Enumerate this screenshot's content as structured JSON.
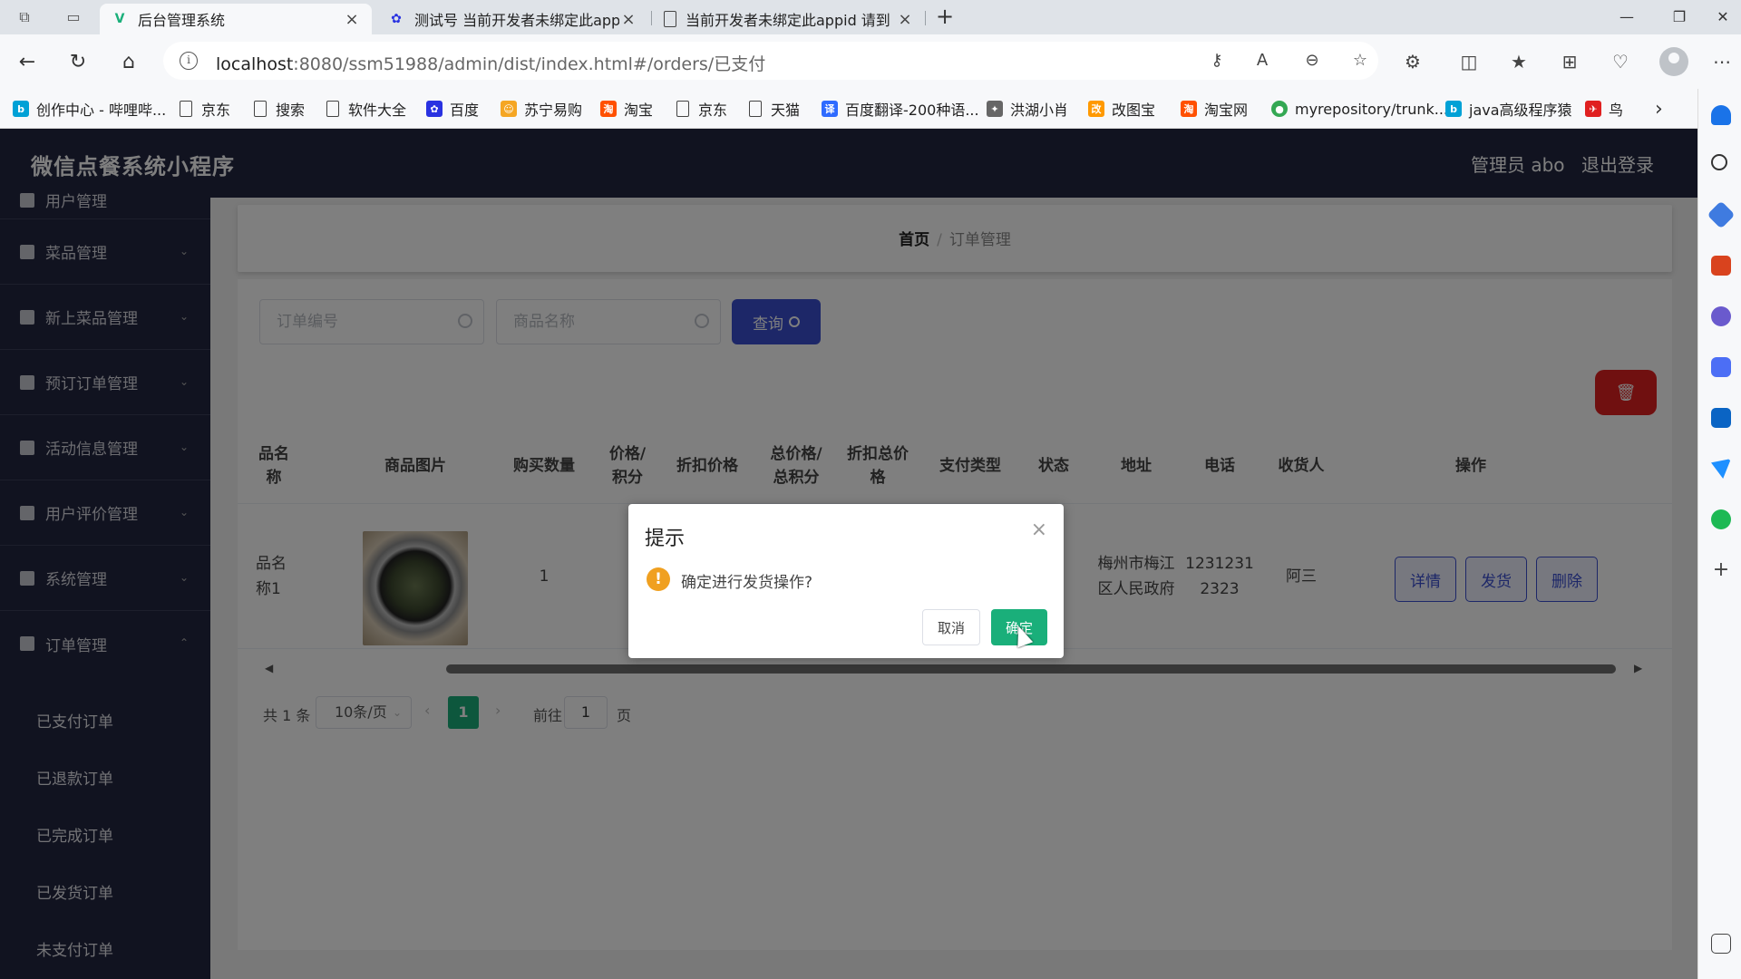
{
  "browser": {
    "tabs": [
      {
        "title": "后台管理系统",
        "favicon": "vue-icon",
        "active": true
      },
      {
        "title": "测试号 当前开发者未绑定此appid",
        "favicon": "baidu-paw-icon",
        "active": false
      },
      {
        "title": "当前开发者未绑定此appid 请到",
        "favicon": "page-icon",
        "active": false
      }
    ],
    "url_host": "localhost",
    "url_rest": ":8080/ssm51988/admin/dist/index.html#/orders/已支付",
    "bookmarks": [
      {
        "label": "创作中心 - 哔哩哔...",
        "icon": "bilibili-icon",
        "color": "#00a1d6"
      },
      {
        "label": "京东",
        "icon": "page-icon"
      },
      {
        "label": "搜索",
        "icon": "page-icon"
      },
      {
        "label": "软件大全",
        "icon": "page-icon"
      },
      {
        "label": "百度",
        "icon": "baidu-paw-icon",
        "color": "#2932e1"
      },
      {
        "label": "苏宁易购",
        "icon": "suning-icon",
        "color": "#f5a623"
      },
      {
        "label": "淘宝",
        "icon": "taobao-icon",
        "color": "#ff5000"
      },
      {
        "label": "京东",
        "icon": "page-icon"
      },
      {
        "label": "天猫",
        "icon": "page-icon"
      },
      {
        "label": "百度翻译-200种语...",
        "icon": "translate-icon",
        "color": "#2f6bff"
      },
      {
        "label": "洪湖小肖",
        "icon": "fox-icon",
        "color": "#666666"
      },
      {
        "label": "改图宝",
        "icon": "image-tool-icon",
        "color": "#ff9900"
      },
      {
        "label": "淘宝网",
        "icon": "taobao-icon",
        "color": "#ff5000"
      },
      {
        "label": "myrepository/trunk...",
        "icon": "chrome-icon",
        "color": "#34a853"
      },
      {
        "label": "java高级程序猿",
        "icon": "bilibili-icon",
        "color": "#00a1d6"
      },
      {
        "label": "鸟",
        "icon": "bird-icon",
        "color": "#e02020"
      }
    ]
  },
  "app": {
    "brand": "微信点餐系统小程序",
    "admin_label": "管理员 abo",
    "logout_label": "退出登录",
    "menu": [
      {
        "label": "用户管理",
        "icon": "user-icon"
      },
      {
        "label": "菜品管理",
        "icon": "send-icon"
      },
      {
        "label": "新上菜品管理",
        "icon": "person-icon"
      },
      {
        "label": "预订订单管理",
        "icon": "flag-icon"
      },
      {
        "label": "活动信息管理",
        "icon": "doc-icon"
      },
      {
        "label": "用户评价管理",
        "icon": "clipboard-icon"
      },
      {
        "label": "系统管理",
        "icon": "mail-icon"
      },
      {
        "label": "订单管理",
        "icon": "chart-icon"
      }
    ],
    "submenu": [
      "已支付订单",
      "已退款订单",
      "已完成订单",
      "已发货订单",
      "未支付订单"
    ],
    "breadcrumb": {
      "home": "首页",
      "sep": "/",
      "current": "订单管理"
    },
    "search": {
      "order_placeholder": "订单编号",
      "product_placeholder": "商品名称",
      "query_label": "查询"
    },
    "table": {
      "headers": [
        "品名称",
        "商品图片",
        "购买数量",
        "价格/积分",
        "折扣价格",
        "总价格/总积分",
        "折扣总价格",
        "支付类型",
        "状态",
        "地址",
        "电话",
        "收货人",
        "操作"
      ],
      "row": {
        "product_name": "品名称1",
        "quantity": "1",
        "address": "梅州市梅江区人民政府",
        "phone": "12312312323",
        "receiver": "阿三"
      },
      "actions": {
        "detail": "详情",
        "ship": "发货",
        "delete": "删除"
      }
    },
    "pager": {
      "total": "共 1 条",
      "page_size": "10条/页",
      "current": "1",
      "goto": "前往",
      "goto_value": "1",
      "page_unit": "页"
    },
    "dialog": {
      "title": "提示",
      "message": "确定进行发货操作?",
      "cancel": "取消",
      "ok": "确定"
    }
  },
  "colors": {
    "sidebar": "#222640",
    "primary": "#3a4fd1",
    "success": "#1aaf7a",
    "danger": "#e02020",
    "warning": "#f0a020"
  }
}
